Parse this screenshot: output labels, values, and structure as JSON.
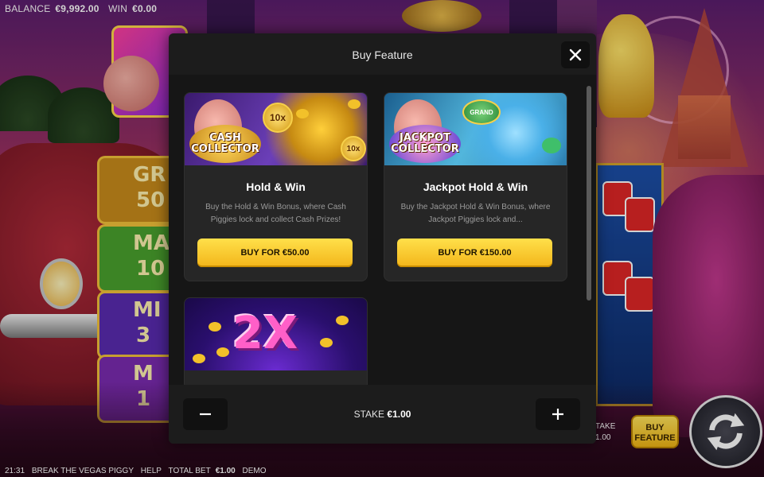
{
  "hud": {
    "balance_label": "BALANCE",
    "balance_value": "€9,992.00",
    "win_label": "WIN",
    "win_value": "€0.00",
    "time": "21:31",
    "game_name": "BREAK THE VEGAS PIGGY",
    "help": "HELP",
    "total_bet_label": "TOTAL BET",
    "total_bet_value": "€1.00",
    "mode": "DEMO",
    "stake_hint_label": "TAKE",
    "stake_hint_value": "1.00",
    "buy_feature_line1": "BUY",
    "buy_feature_line2": "FEATURE"
  },
  "background": {
    "plaques": [
      "GR",
      "MA",
      "MI",
      "M"
    ],
    "plaque_values": [
      "50",
      "10",
      "3",
      "1"
    ]
  },
  "modal": {
    "title": "Buy Feature",
    "stake_label": "STAKE",
    "stake_value": "€1.00",
    "cards": [
      {
        "title": "Hold & Win",
        "description": "Buy the Hold & Win Bonus, where Cash Piggies lock and collect Cash Prizes!",
        "buy_label": "BUY FOR €50.00",
        "art_text": "CASH COLLECTOR",
        "coin_label": "10x"
      },
      {
        "title": "Jackpot Hold & Win",
        "description": "Buy the Jackpot Hold & Win Bonus, where Jackpot Piggies lock and...",
        "buy_label": "BUY FOR €150.00",
        "art_text": "JACKPOT COLLECTOR",
        "coin_label": "GRAND"
      },
      {
        "art_text": "2X"
      }
    ]
  },
  "colors": {
    "accent_button": "#f3b51a",
    "modal_bg": "#1c1c1c",
    "card_bg": "#262626"
  }
}
